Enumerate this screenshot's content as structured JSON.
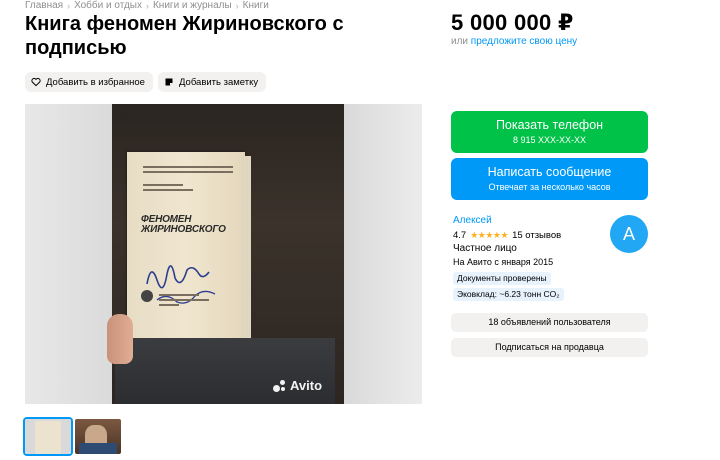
{
  "breadcrumbs": [
    "Главная",
    "Хобби и отдых",
    "Книги и журналы",
    "Книги"
  ],
  "title": "Книга феномен Жириновского с подписью",
  "price": {
    "amount": "5 000 000 ₽",
    "or_text": "или",
    "suggest_link": "предложите свою цену"
  },
  "actions": {
    "favorite": "Добавить в избранное",
    "note": "Добавить заметку"
  },
  "gallery": {
    "watermark": "Avito",
    "book_title_1": "ФЕНОМЕН",
    "book_title_2": "ЖИРИНОВСКОГО",
    "thumbnails_count": 2
  },
  "contact": {
    "phone_label": "Показать телефон",
    "phone_number": "8 915 XXX-XX-XX",
    "message_label": "Написать сообщение",
    "message_sub": "Отвечает за несколько часов"
  },
  "seller": {
    "name": "Алексей",
    "rating": "4.7",
    "stars": "★★★★★",
    "reviews": "15 отзывов",
    "type": "Частное лицо",
    "since": "На Авито с января 2015",
    "badge_docs": "Документы проверены",
    "badge_eco": "Эковклад: ~6.23 тонн CO₂",
    "avatar_letter": "А"
  },
  "buttons": {
    "listings": "18 объявлений пользователя",
    "subscribe": "Подписаться на продавца"
  },
  "colors": {
    "green": "#00c248",
    "blue": "#0099f7",
    "star": "#ffb021",
    "avatar": "#21a7f3"
  }
}
